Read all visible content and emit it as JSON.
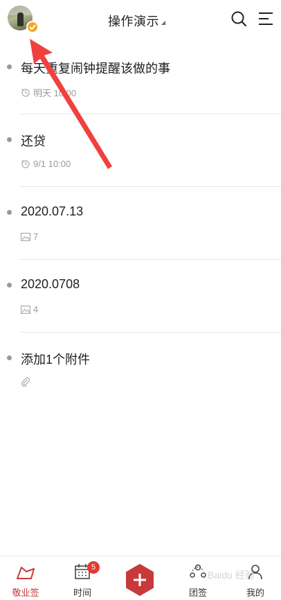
{
  "header": {
    "title": "操作演示",
    "avatar_icon": "avatar-photo",
    "badge_icon": "vip-check-icon",
    "search_icon": "search-icon",
    "menu_icon": "menu-lines-icon"
  },
  "notes": [
    {
      "title": "每天重复闹钟提醒该做的事",
      "meta_icon": "alarm-repeat-icon",
      "meta_text": "明天 10:00"
    },
    {
      "title": "还贷",
      "meta_icon": "alarm-repeat-icon",
      "meta_text": "9/1 10:00"
    },
    {
      "title": "2020.07.13",
      "meta_icon": "image-icon",
      "meta_text": "7"
    },
    {
      "title": "2020.0708",
      "meta_icon": "image-icon",
      "meta_text": "4"
    },
    {
      "title": "添加1个附件",
      "meta_icon": "paperclip-icon",
      "meta_text": ""
    }
  ],
  "bottom_nav": {
    "items": [
      {
        "label": "敬业签",
        "icon": "note-tab-icon",
        "active": true
      },
      {
        "label": "时间",
        "icon": "calendar-icon",
        "badge": "5"
      },
      {
        "label": "",
        "icon": "add-hexagon-icon"
      },
      {
        "label": "团签",
        "icon": "team-icon"
      },
      {
        "label": "我的",
        "icon": "person-icon"
      }
    ]
  },
  "colors": {
    "accent": "#c8393a",
    "badge": "#e53935",
    "annotation_arrow": "#f0413f"
  },
  "watermark": "Baidu 经验"
}
